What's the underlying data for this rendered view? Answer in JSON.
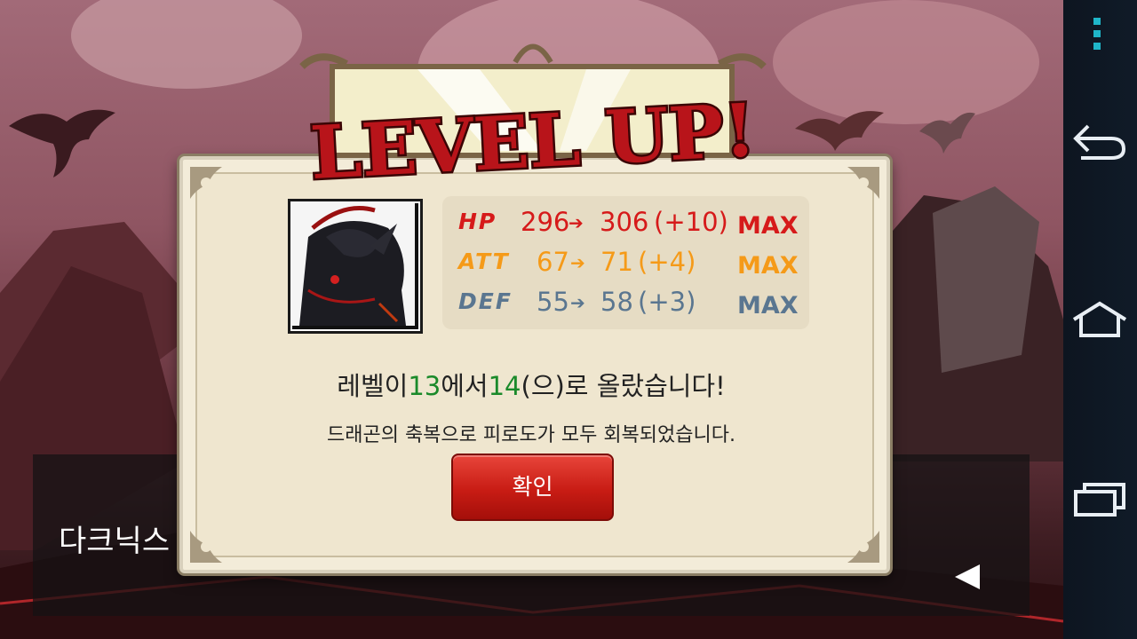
{
  "title": "LEVEL UP!",
  "stats": [
    {
      "label": "HP",
      "before": "296",
      "after": "306",
      "gain": "(+10)",
      "max": "MAX",
      "label_color": "#d61a1a",
      "value_color": "#d61a1a",
      "max_color": "#d61a1a"
    },
    {
      "label": "ATT",
      "before": "67",
      "after": "71",
      "gain": "(+4)",
      "max": "MAX",
      "label_color": "#f59a18",
      "value_color": "#f59a18",
      "max_color": "#f59a18"
    },
    {
      "label": "DEF",
      "before": "55",
      "after": "58",
      "gain": "(+3)",
      "max": "MAX",
      "label_color": "#5a7690",
      "value_color": "#5a7690",
      "max_color": "#5a7690"
    }
  ],
  "arrow_glyph": "➔",
  "message": {
    "prefix": "레벨이 ",
    "from_level": "13",
    "mid": "에서 ",
    "to_level": "14",
    "suffix": "(으)로 올랐습니다!",
    "level_color": "#1a8a2a"
  },
  "blessing": "드래곤의 축복으로 피로도가 모두 회복되었습니다.",
  "confirm_label": "확인",
  "speaker_name": "다크닉스",
  "nav": {
    "back_icon": "back-icon",
    "home_icon": "home-icon",
    "recents_icon": "recents-icon",
    "menu_icon": "overflow-menu-icon"
  }
}
